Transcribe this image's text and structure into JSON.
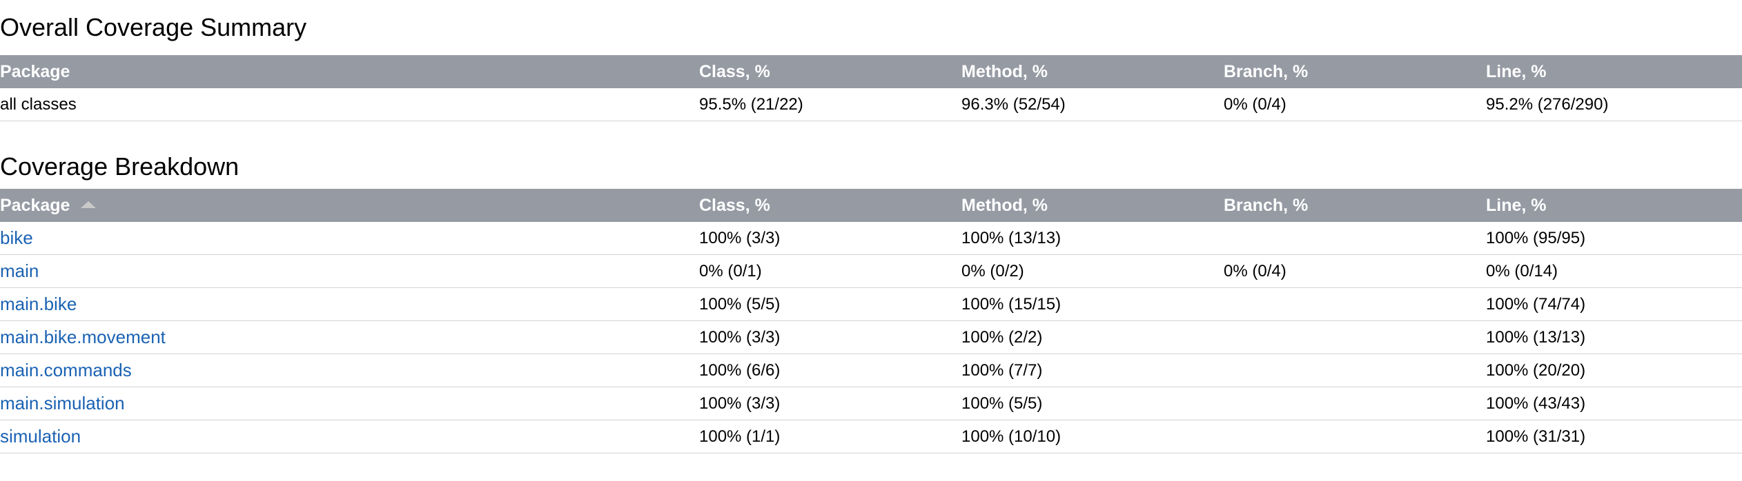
{
  "summary": {
    "title": "Overall Coverage Summary",
    "headers": [
      "Package",
      "Class, %",
      "Method, %",
      "Branch, %",
      "Line, %"
    ],
    "row": [
      "all classes",
      "95.5% (21/22)",
      "96.3% (52/54)",
      "0% (0/4)",
      "95.2% (276/290)"
    ]
  },
  "breakdown": {
    "title": "Coverage Breakdown",
    "headers": [
      "Package",
      "Class, %",
      "Method, %",
      "Branch, %",
      "Line, %"
    ],
    "sort_icon": "sort-ascending-icon",
    "rows": [
      [
        "bike",
        "100% (3/3)",
        "100% (13/13)",
        "",
        "100% (95/95)"
      ],
      [
        "main",
        "0% (0/1)",
        "0% (0/2)",
        "0% (0/4)",
        "0% (0/14)"
      ],
      [
        "main.bike",
        "100% (5/5)",
        "100% (15/15)",
        "",
        "100% (74/74)"
      ],
      [
        "main.bike.movement",
        "100% (3/3)",
        "100% (2/2)",
        "",
        "100% (13/13)"
      ],
      [
        "main.commands",
        "100% (6/6)",
        "100% (7/7)",
        "",
        "100% (20/20)"
      ],
      [
        "main.simulation",
        "100% (3/3)",
        "100% (5/5)",
        "",
        "100% (43/43)"
      ],
      [
        "simulation",
        "100% (1/1)",
        "100% (10/10)",
        "",
        "100% (31/31)"
      ]
    ]
  },
  "colors": {
    "header_bg": "#959aa3",
    "link": "#1a62b3",
    "row_border": "#d2d2d2"
  }
}
